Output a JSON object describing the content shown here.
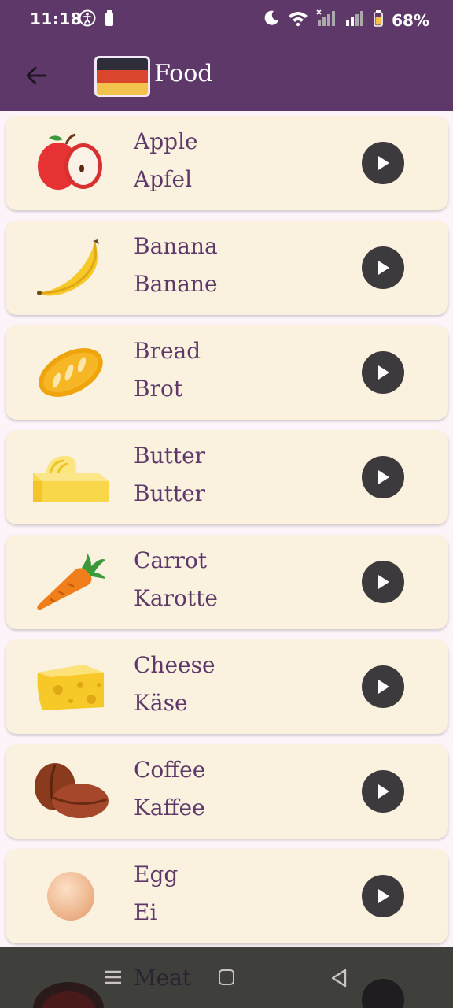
{
  "status": {
    "time": "11:18",
    "battery_pct": "68%"
  },
  "appbar": {
    "title": "Food",
    "flag_colors": [
      "#2e2e3a",
      "#d9452d",
      "#f2c24c"
    ]
  },
  "items": [
    {
      "en": "Apple",
      "de": "Apfel",
      "icon": "apple-icon"
    },
    {
      "en": "Banana",
      "de": "Banane",
      "icon": "banana-icon"
    },
    {
      "en": "Bread",
      "de": "Brot",
      "icon": "bread-icon"
    },
    {
      "en": "Butter",
      "de": "Butter",
      "icon": "butter-icon"
    },
    {
      "en": "Carrot",
      "de": "Karotte",
      "icon": "carrot-icon"
    },
    {
      "en": "Cheese",
      "de": "Käse",
      "icon": "cheese-icon"
    },
    {
      "en": "Coffee",
      "de": "Kaffee",
      "icon": "coffee-icon"
    },
    {
      "en": "Egg",
      "de": "Ei",
      "icon": "egg-icon"
    }
  ],
  "peek": {
    "label": "Meat",
    "icon": "meat-icon"
  },
  "colors": {
    "appbar": "#5e3868",
    "card": "#faf2df",
    "text": "#5e3868",
    "play": "#3d3a3e"
  }
}
